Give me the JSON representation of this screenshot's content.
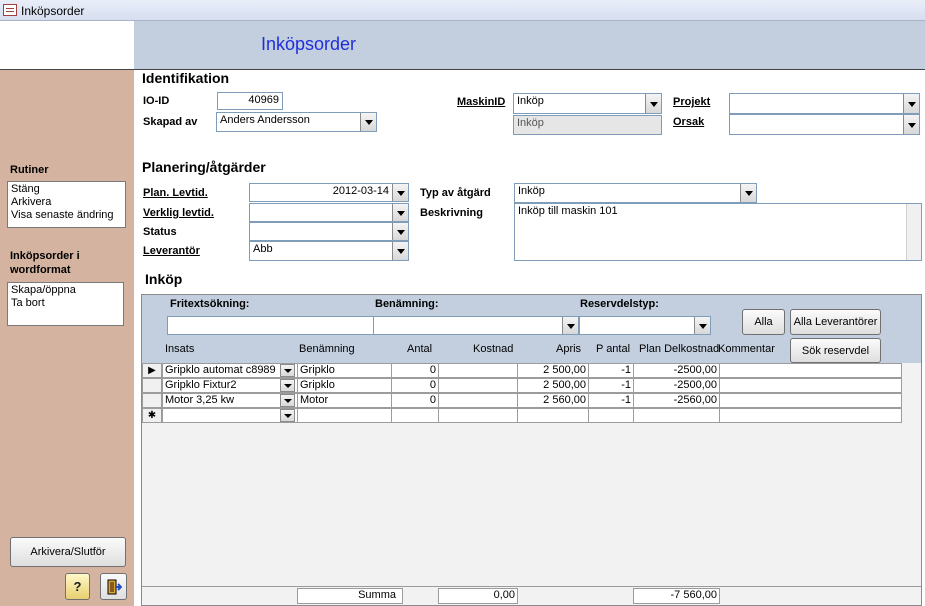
{
  "window": {
    "title": "Inköpsorder"
  },
  "header": {
    "title": "Inköpsorder"
  },
  "sidebar": {
    "rutiner_title": "Rutiner",
    "rutiner_items": [
      "Stäng",
      "Arkivera",
      "Visa senaste ändring"
    ],
    "word_title": "Inköpsorder i wordformat",
    "word_items": [
      "Skapa/öppna",
      "Ta bort"
    ],
    "archive_button": "Arkivera/Slutför"
  },
  "identifikation": {
    "title": "Identifikation",
    "io_id_label": "IO-ID",
    "io_id_value": "40969",
    "skapad_av_label": "Skapad av",
    "skapad_av_value": "Anders Andersson",
    "maskinid_label": "MaskinID",
    "maskinid_value": "Inköp",
    "maskinid_sub": "Inköp",
    "projekt_label": "Projekt",
    "projekt_value": "",
    "orsak_label": "Orsak",
    "orsak_value": ""
  },
  "planering": {
    "title": "Planering/åtgärder",
    "plan_levtid_label": "Plan. Levtid.",
    "plan_levtid_value": "2012-03-14",
    "verklig_levtid_label": "Verklig levtid.",
    "verklig_levtid_value": "",
    "status_label": "Status",
    "status_value": "",
    "leverantor_label": "Leverantör",
    "leverantor_value": "Abb",
    "typ_label": "Typ av åtgärd",
    "typ_value": "Inköp",
    "beskrivning_label": "Beskrivning",
    "beskrivning_value": "Inköp till maskin 101"
  },
  "inkop": {
    "title": "Inköp",
    "fritext_label": "Fritextsökning:",
    "benamning_label": "Benämning:",
    "reservdelstyp_label": "Reservdelstyp:",
    "alla_button": "Alla",
    "alla_lev_button": "Alla Leverantörer",
    "sok_button": "Sök reservdel",
    "columns": [
      "Insats",
      "Benämning",
      "Antal",
      "Kostnad",
      "Apris",
      "P antal",
      "Plan Delkostnad",
      "Kommentar"
    ],
    "rows": [
      {
        "insats": "Gripklo automat c8989",
        "benamning": "Gripklo",
        "antal": "0",
        "kostnad": "",
        "apris": "2 500,00",
        "pantal": "-1",
        "plan": "-2500,00",
        "kommentar": ""
      },
      {
        "insats": "Gripklo Fixtur2",
        "benamning": "Gripklo",
        "antal": "0",
        "kostnad": "",
        "apris": "2 500,00",
        "pantal": "-1",
        "plan": "-2500,00",
        "kommentar": ""
      },
      {
        "insats": "Motor 3,25 kw",
        "benamning": "Motor",
        "antal": "0",
        "kostnad": "",
        "apris": "2 560,00",
        "pantal": "-1",
        "plan": "-2560,00",
        "kommentar": ""
      }
    ],
    "new_row_marker": "✱",
    "summa_label": "Summa",
    "summa_kostnad": "0,00",
    "summa_plan": "-7 560,00"
  }
}
